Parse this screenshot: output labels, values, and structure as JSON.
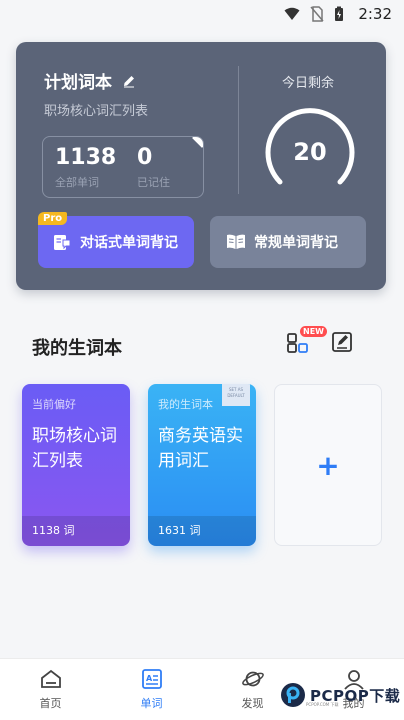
{
  "status_bar": {
    "time": "2:32"
  },
  "plan_card": {
    "title": "计划词本",
    "subtitle": "职场核心词汇列表",
    "total_count": "1138",
    "total_label": "全部单词",
    "learned_count": "0",
    "learned_label": "已记住",
    "remaining_label": "今日剩余",
    "remaining_value": "20",
    "dialog_button": {
      "label": "对话式单词背记",
      "badge": "Pro"
    },
    "normal_button": {
      "label": "常规单词背记"
    }
  },
  "vocab": {
    "title": "我的生词本",
    "new_badge": "NEW",
    "books": [
      {
        "tag": "当前偏好",
        "name": "职场核心词汇列表",
        "count": "1138 词"
      },
      {
        "tag": "我的生词本",
        "name": "商务英语实用词汇",
        "count": "1631 词",
        "ribbon": "SET AS DEFAULT"
      }
    ],
    "add_symbol": "+"
  },
  "nav": [
    {
      "label": "首页"
    },
    {
      "label": "单词"
    },
    {
      "label": "发现"
    },
    {
      "label": "我的"
    }
  ],
  "watermark": {
    "text": "PCPOP下载",
    "small": "PCPOP.COM 下载"
  },
  "colors": {
    "card": "#5b6478",
    "primary": "#6d68f2",
    "accent_blue": "#2f7df6"
  }
}
